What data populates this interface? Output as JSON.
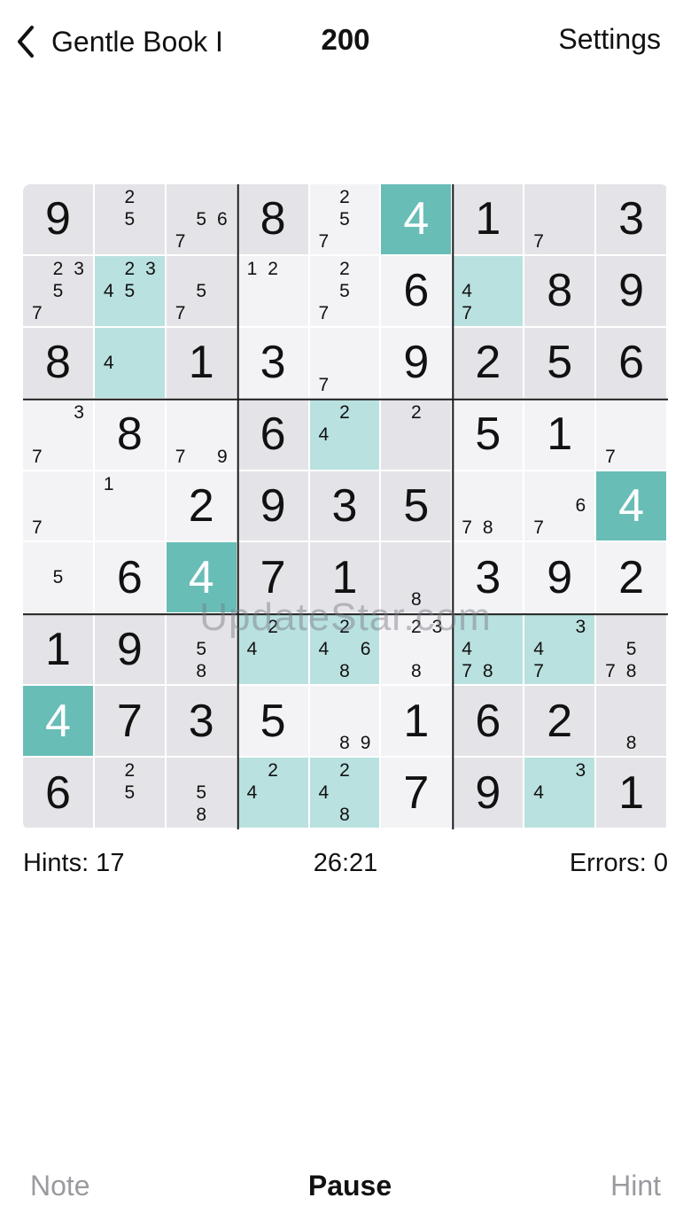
{
  "header": {
    "back_label": "Gentle Book I",
    "back_icon": "chevron-left-icon",
    "puzzle_number": "200",
    "settings_label": "Settings"
  },
  "board": {
    "cells": [
      {
        "v": "9",
        "s": "dark"
      },
      {
        "n": [
          "2",
          "5"
        ],
        "np": [
          2,
          5
        ],
        "s": "dark"
      },
      {
        "n": [
          "5",
          "6",
          "7"
        ],
        "np": [
          5,
          6,
          7
        ],
        "s": "dark"
      },
      {
        "v": "8",
        "s": "dark"
      },
      {
        "n": [
          "2",
          "5",
          "7"
        ],
        "np": [
          2,
          5,
          7
        ],
        "s": "light"
      },
      {
        "v": "4",
        "s": "sel"
      },
      {
        "v": "1",
        "s": "dark"
      },
      {
        "n": [
          "7"
        ],
        "np": [
          7
        ],
        "s": "dark"
      },
      {
        "v": "3",
        "s": "dark"
      },
      {
        "n": [
          "2",
          "3",
          "5",
          "7"
        ],
        "np": [
          2,
          3,
          5,
          7
        ],
        "s": "dark"
      },
      {
        "n": [
          "2",
          "3",
          "4",
          "5"
        ],
        "np": [
          2,
          3,
          4,
          5
        ],
        "s": "hl"
      },
      {
        "n": [
          "5",
          "7"
        ],
        "np": [
          5,
          7
        ],
        "s": "dark"
      },
      {
        "n": [
          "1",
          "2"
        ],
        "np": [
          1,
          2
        ],
        "s": "light"
      },
      {
        "n": [
          "2",
          "5",
          "7"
        ],
        "np": [
          2,
          5,
          7
        ],
        "s": "light"
      },
      {
        "v": "6",
        "s": "light"
      },
      {
        "n": [
          "4",
          "7"
        ],
        "np": [
          4,
          7
        ],
        "s": "hl"
      },
      {
        "v": "8",
        "s": "dark"
      },
      {
        "v": "9",
        "s": "dark"
      },
      {
        "v": "8",
        "s": "dark"
      },
      {
        "n": [
          "4"
        ],
        "np": [
          4
        ],
        "s": "hl"
      },
      {
        "v": "1",
        "s": "dark"
      },
      {
        "v": "3",
        "s": "light"
      },
      {
        "n": [
          "7"
        ],
        "np": [
          7
        ],
        "s": "light"
      },
      {
        "v": "9",
        "s": "light"
      },
      {
        "v": "2",
        "s": "dark"
      },
      {
        "v": "5",
        "s": "dark"
      },
      {
        "v": "6",
        "s": "dark"
      },
      {
        "n": [
          "3",
          "7"
        ],
        "np": [
          3,
          7
        ],
        "s": "light"
      },
      {
        "v": "8",
        "s": "light"
      },
      {
        "n": [
          "7",
          "9"
        ],
        "np": [
          7,
          9
        ],
        "s": "light"
      },
      {
        "v": "6",
        "s": "dark"
      },
      {
        "n": [
          "2",
          "4"
        ],
        "np": [
          2,
          4
        ],
        "s": "hl"
      },
      {
        "n": [
          "2"
        ],
        "np": [
          2
        ],
        "s": "dark"
      },
      {
        "v": "5",
        "s": "light"
      },
      {
        "v": "1",
        "s": "light"
      },
      {
        "n": [
          "7"
        ],
        "np": [
          7
        ],
        "s": "light"
      },
      {
        "n": [
          "7"
        ],
        "np": [
          7
        ],
        "s": "light"
      },
      {
        "n": [
          "1"
        ],
        "np": [
          1
        ],
        "s": "light"
      },
      {
        "v": "2",
        "s": "light"
      },
      {
        "v": "9",
        "s": "dark"
      },
      {
        "v": "3",
        "s": "dark"
      },
      {
        "v": "5",
        "s": "dark"
      },
      {
        "n": [
          "7",
          "8"
        ],
        "np": [
          7,
          8
        ],
        "s": "light"
      },
      {
        "n": [
          "6",
          "7"
        ],
        "np": [
          6,
          7
        ],
        "s": "light"
      },
      {
        "v": "4",
        "s": "sel"
      },
      {
        "n": [
          "5"
        ],
        "np": [
          5
        ],
        "s": "light"
      },
      {
        "v": "6",
        "s": "light"
      },
      {
        "v": "4",
        "s": "sel"
      },
      {
        "v": "7",
        "s": "dark"
      },
      {
        "v": "1",
        "s": "dark"
      },
      {
        "n": [
          "8"
        ],
        "np": [
          8
        ],
        "s": "dark"
      },
      {
        "v": "3",
        "s": "light"
      },
      {
        "v": "9",
        "s": "light"
      },
      {
        "v": "2",
        "s": "light"
      },
      {
        "v": "1",
        "s": "dark"
      },
      {
        "v": "9",
        "s": "dark"
      },
      {
        "n": [
          "5",
          "8"
        ],
        "np": [
          5,
          8
        ],
        "s": "dark"
      },
      {
        "n": [
          "2",
          "4"
        ],
        "np": [
          2,
          4
        ],
        "s": "hl"
      },
      {
        "n": [
          "2",
          "4",
          "6",
          "8"
        ],
        "np": [
          2,
          4,
          6,
          8
        ],
        "s": "hl"
      },
      {
        "n": [
          "2",
          "3",
          "8"
        ],
        "np": [
          2,
          3,
          8
        ],
        "s": "light"
      },
      {
        "n": [
          "4",
          "7",
          "8"
        ],
        "np": [
          4,
          7,
          8
        ],
        "s": "hl"
      },
      {
        "n": [
          "3",
          "4",
          "7"
        ],
        "np": [
          3,
          4,
          7
        ],
        "s": "hl"
      },
      {
        "n": [
          "5",
          "7",
          "8"
        ],
        "np": [
          5,
          7,
          8
        ],
        "s": "dark"
      },
      {
        "v": "4",
        "s": "sel"
      },
      {
        "v": "7",
        "s": "dark"
      },
      {
        "v": "3",
        "s": "dark"
      },
      {
        "v": "5",
        "s": "light"
      },
      {
        "n": [
          "8",
          "9"
        ],
        "np": [
          8,
          9
        ],
        "s": "light"
      },
      {
        "v": "1",
        "s": "light"
      },
      {
        "v": "6",
        "s": "dark"
      },
      {
        "v": "2",
        "s": "dark"
      },
      {
        "n": [
          "8"
        ],
        "np": [
          8
        ],
        "s": "dark"
      },
      {
        "v": "6",
        "s": "dark"
      },
      {
        "n": [
          "2",
          "5"
        ],
        "np": [
          2,
          5
        ],
        "s": "dark"
      },
      {
        "n": [
          "5",
          "8"
        ],
        "np": [
          5,
          8
        ],
        "s": "dark"
      },
      {
        "n": [
          "2",
          "4"
        ],
        "np": [
          2,
          4
        ],
        "s": "hl"
      },
      {
        "n": [
          "2",
          "4",
          "8"
        ],
        "np": [
          2,
          4,
          8
        ],
        "s": "hl"
      },
      {
        "v": "7",
        "s": "light"
      },
      {
        "v": "9",
        "s": "dark"
      },
      {
        "n": [
          "3",
          "4"
        ],
        "np": [
          3,
          4
        ],
        "s": "hl"
      },
      {
        "v": "1",
        "s": "dark"
      }
    ]
  },
  "watermark": "UpdateStar.com",
  "stats": {
    "hints": "Hints: 17",
    "timer": "26:21",
    "errors": "Errors: 0"
  },
  "toolbar": {
    "note_label": "Note",
    "pause_label": "Pause",
    "hint_label": "Hint"
  },
  "colors": {
    "selected": "#68bdb7",
    "highlight": "#b9e1df",
    "cell_dark": "#e4e4e8",
    "cell_light": "#f3f3f6"
  }
}
